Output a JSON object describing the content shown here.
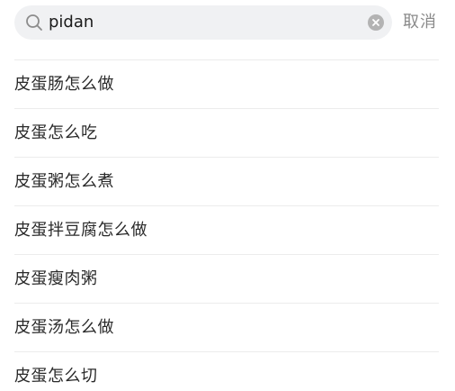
{
  "search": {
    "query": "pidan",
    "cancel_label": "取消"
  },
  "suggestions": [
    "皮蛋肠怎么做",
    "皮蛋怎么吃",
    "皮蛋粥怎么煮",
    "皮蛋拌豆腐怎么做",
    "皮蛋瘦肉粥",
    "皮蛋汤怎么做",
    "皮蛋怎么切"
  ],
  "icons": {
    "search": "search-icon",
    "clear": "clear-icon"
  },
  "colors": {
    "search_bg": "#f0f1f3",
    "cancel_text": "#8a8a8a",
    "clear_bg": "#b3b3b3",
    "divider": "#ececec"
  }
}
